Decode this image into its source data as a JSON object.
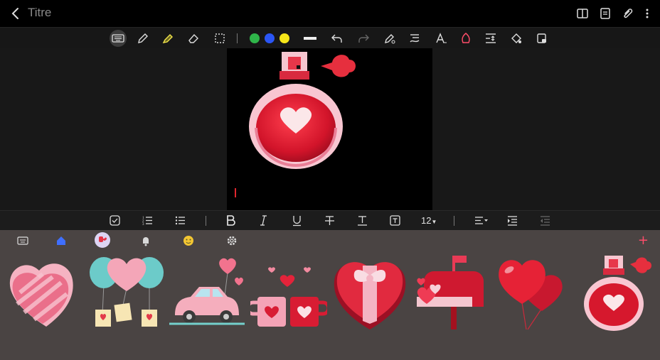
{
  "header": {
    "title": "Titre",
    "icons": [
      "back-arrow-icon",
      "book-icon",
      "page-list-icon",
      "attach-icon",
      "more-icon"
    ]
  },
  "toolbar": {
    "icons": [
      "keyboard-icon",
      "pen-icon",
      "highlighter-icon",
      "eraser-icon",
      "selection-icon",
      "color-green",
      "color-blue",
      "color-yellow",
      "stroke-width-icon",
      "undo-icon",
      "redo-icon",
      "pen-settings-icon",
      "text-style-icon",
      "handwriting-icon",
      "shape-icon",
      "insert-space-icon",
      "fill-icon",
      "lock-icon"
    ],
    "colors": {
      "green": "#2fb54a",
      "blue": "#2b56f5",
      "yellow": "#f6e619"
    }
  },
  "format_bar": {
    "font_size": "12"
  },
  "sticker_panel": {
    "tabs": [
      "keyboard-tab",
      "home-tab",
      "valentine-tab",
      "bell-tab",
      "emoji-tab",
      "settings-tab"
    ],
    "selected_tab": "valentine-tab",
    "add_label": "+",
    "stickers": [
      "pink-heart-sticker",
      "heart-balloons-sticker",
      "pink-car-sticker",
      "heart-mugs-sticker",
      "heart-gift-box-sticker",
      "mailbox-hearts-sticker",
      "red-heart-balloons-sticker",
      "perfume-bottle-sticker"
    ]
  },
  "colors": {
    "accent": "#ff4d6a",
    "canvas_bg": "#000000",
    "panel_bg": "#4a4443"
  }
}
